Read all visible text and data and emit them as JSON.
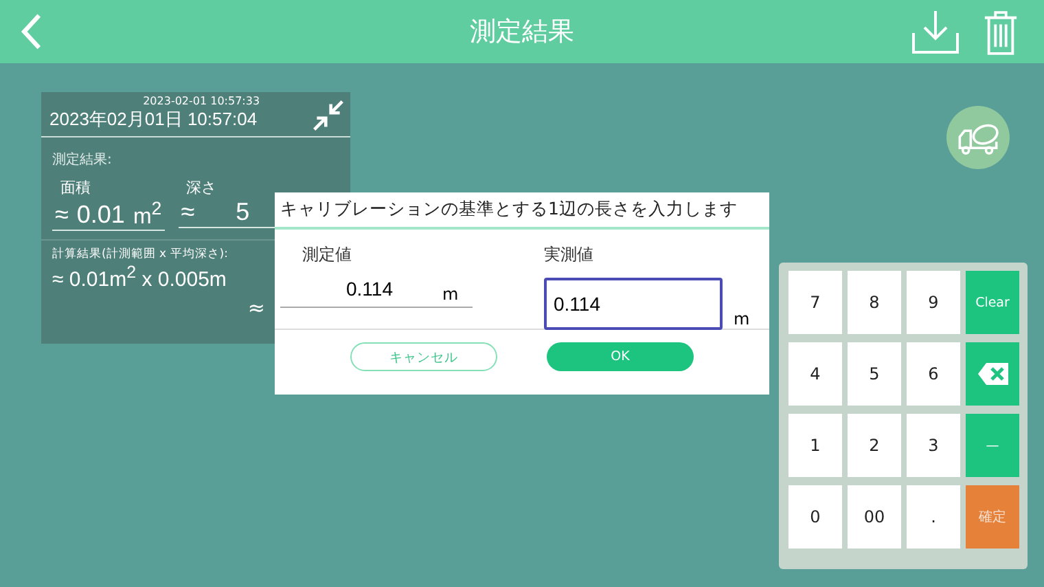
{
  "header": {
    "title": "測定結果"
  },
  "card": {
    "timestamp": "2023-02-01 10:57:33",
    "datetime": "2023年02月01日 10:57:04",
    "section_label": "測定結果:",
    "fields": [
      {
        "label": "面積",
        "approx": "≈",
        "value": "0.01",
        "unit": "m$^{2}$"
      },
      {
        "label": "深さ",
        "approx": "≈",
        "value": "5"
      }
    ],
    "calc_label": "計算結果(計測範囲 x 平均深さ):",
    "calc_value": "≈ 0.01m$^{2}$ x 0.005m",
    "result_approx": "≈"
  },
  "dialog": {
    "title": "キャリブレーションの基準とする1辺の長さを入力します",
    "columns": [
      {
        "label": "測定値",
        "value": "0.114",
        "unit": "m",
        "kind": "readonly"
      },
      {
        "label": "実測値",
        "value": "0.114",
        "unit": "m",
        "kind": "input"
      }
    ],
    "buttons": [
      {
        "label": "キャンセル",
        "kind": "secondary"
      },
      {
        "label": "OK",
        "kind": "primary"
      }
    ]
  },
  "keypad": [
    {
      "label": "7",
      "kind": "digit"
    },
    {
      "label": "8",
      "kind": "digit"
    },
    {
      "label": "9",
      "kind": "digit"
    },
    {
      "label": "Clear",
      "kind": "action"
    },
    {
      "label": "4",
      "kind": "digit"
    },
    {
      "label": "5",
      "kind": "digit"
    },
    {
      "label": "6",
      "kind": "digit"
    },
    {
      "kind": "backspace"
    },
    {
      "label": "1",
      "kind": "digit"
    },
    {
      "label": "2",
      "kind": "digit"
    },
    {
      "label": "3",
      "kind": "digit"
    },
    {
      "label": "—",
      "kind": "action"
    },
    {
      "label": "0",
      "kind": "digit"
    },
    {
      "label": "00",
      "kind": "digit"
    },
    {
      "label": ".",
      "kind": "digit"
    },
    {
      "label": "確定",
      "kind": "confirm"
    }
  ]
}
